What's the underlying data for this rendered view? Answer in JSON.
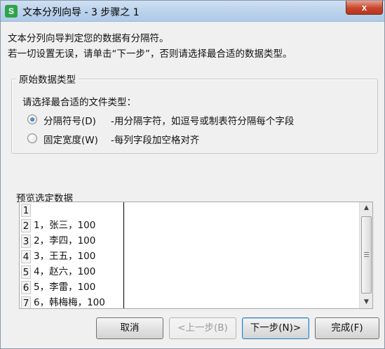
{
  "window": {
    "title": "文本分列向导 - 3 步骤之 1",
    "app_icon_letter": "S",
    "close_glyph": "x"
  },
  "intro": {
    "line1": "文本分列向导判定您的数据有分隔符。",
    "line2": "若一切设置无误，请单击“下一步”，否则请选择最合适的数据类型。"
  },
  "data_type_group": {
    "title": "原始数据类型",
    "prompt": "请选择最合适的文件类型：",
    "options": [
      {
        "label": "分隔符号(D)",
        "description": "-用分隔字符，如逗号或制表符分隔每个字段",
        "selected": true
      },
      {
        "label": "固定宽度(W)",
        "description": "-每列字段加空格对齐",
        "selected": false
      }
    ]
  },
  "preview": {
    "title": "预览选定数据",
    "rows": [
      {
        "num": "1",
        "text": ""
      },
      {
        "num": "2",
        "text": "1，张三，100"
      },
      {
        "num": "3",
        "text": "2，李四，100"
      },
      {
        "num": "4",
        "text": "3，王五，100"
      },
      {
        "num": "5",
        "text": "4，赵六，100"
      },
      {
        "num": "6",
        "text": "5，李雷，100"
      },
      {
        "num": "7",
        "text": "6，韩梅梅，100"
      }
    ]
  },
  "buttons": {
    "cancel": "取消",
    "back": "<上一步(B)",
    "next": "下一步(N)>",
    "finish": "完成(F)"
  }
}
